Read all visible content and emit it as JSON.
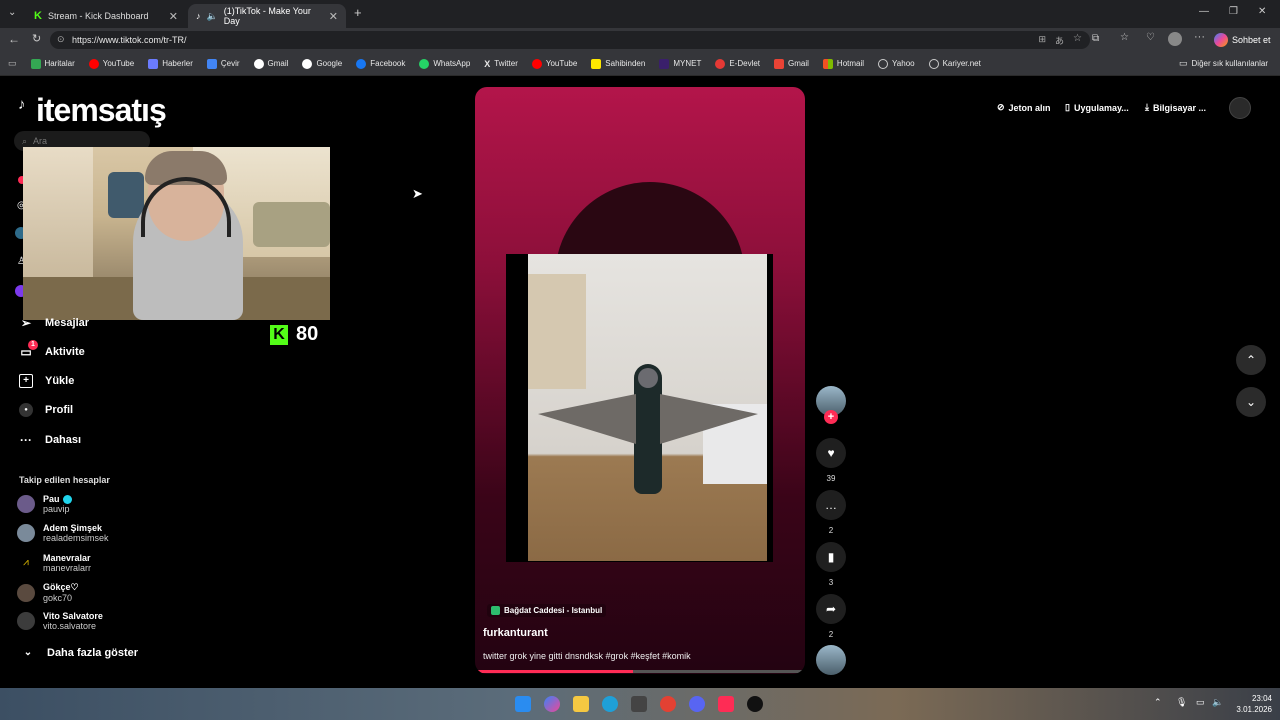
{
  "browser": {
    "tabs": [
      {
        "label": "Stream - Kick Dashboard",
        "active": false
      },
      {
        "label": "(1)TikTok - Make Your Day",
        "active": true
      }
    ],
    "url": "https://www.tiktok.com/tr-TR/",
    "chat_label": "Sohbet et",
    "bookmarks": [
      "Haritalar",
      "YouTube",
      "Haberler",
      "Çevir",
      "Gmail",
      "Google",
      "Facebook",
      "WhatsApp",
      "Twitter",
      "YouTube",
      "Sahibinden",
      "MYNET",
      "E-Devlet",
      "Gmail",
      "Hotmail",
      "Yahoo",
      "Kariyer.net"
    ],
    "other_bookmarks": "Diğer sık kullanılanlar"
  },
  "overlay": {
    "logo_text": "itemsatış",
    "kick_count": "80"
  },
  "sidebar": {
    "search_placeholder": "Ara",
    "items": [
      {
        "label": "Mesajlar"
      },
      {
        "label": "Aktivite",
        "badge": "1"
      },
      {
        "label": "Yükle"
      },
      {
        "label": "Profil"
      },
      {
        "label": "Dahası"
      }
    ],
    "following_title": "Takip edilen hesaplar",
    "following": [
      {
        "name": "Pau",
        "handle": "pauvip"
      },
      {
        "name": "Adem Şimşek",
        "handle": "realademsimsek"
      },
      {
        "name": "Manevralar",
        "handle": "manevralarr"
      },
      {
        "name": "Gökçe♡",
        "handle": "gokc70"
      },
      {
        "name": "Vito Salvatore",
        "handle": "vito.salvatore"
      }
    ],
    "show_more": "Daha fazla göster"
  },
  "header": {
    "coins": "Jeton alın",
    "app": "Uygulamay...",
    "computer": "Bilgisayar ..."
  },
  "video": {
    "location": "Bağdat Caddesi - Istanbul",
    "author": "furkanturant",
    "caption": "twitter grok yine gitti dnsndksk #grok #keşfet #komik",
    "likes": "39",
    "comments": "2",
    "saves": "3",
    "shares": "2"
  },
  "taskbar": {
    "time": "23:04",
    "date": "3.01.2026"
  }
}
